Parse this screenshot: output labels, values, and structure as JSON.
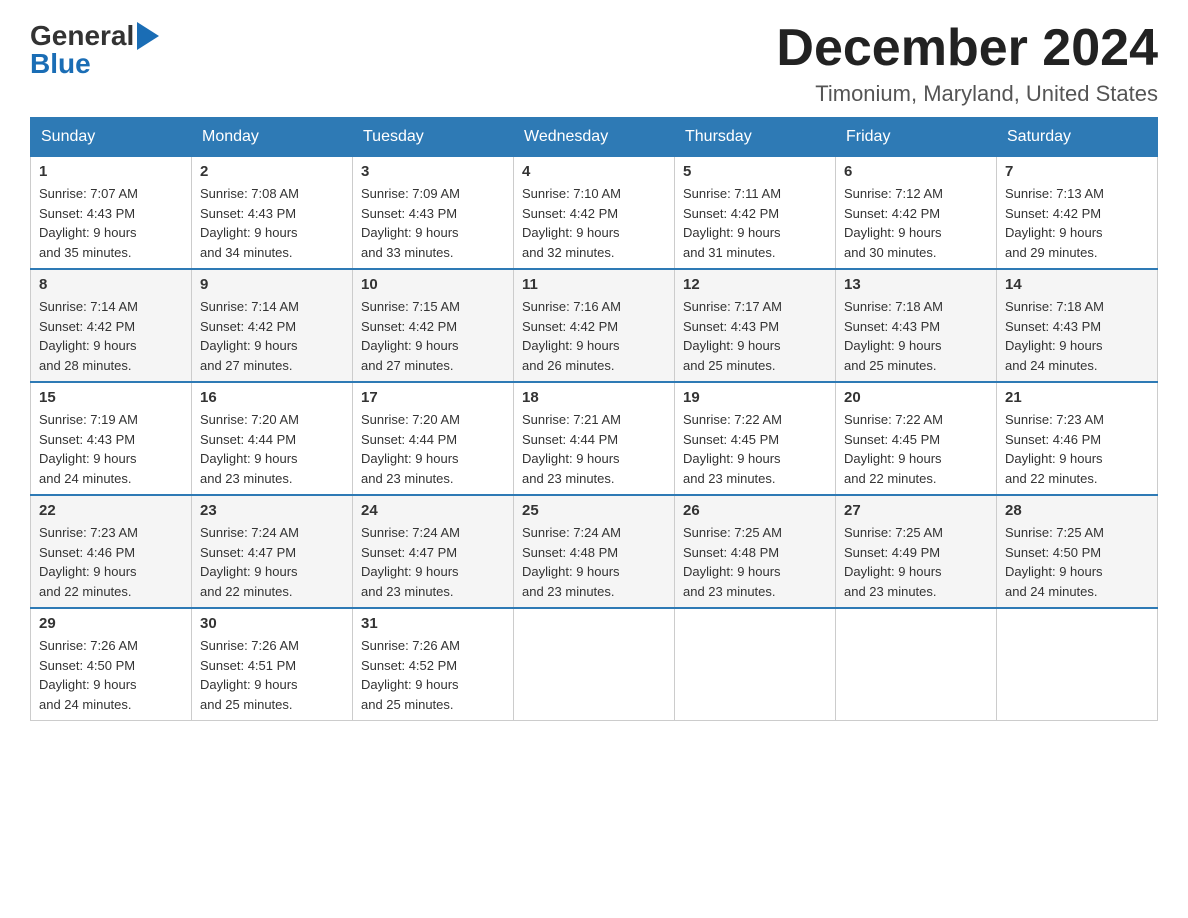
{
  "header": {
    "logo_general": "General",
    "logo_blue": "Blue",
    "month_title": "December 2024",
    "location": "Timonium, Maryland, United States"
  },
  "days_of_week": [
    "Sunday",
    "Monday",
    "Tuesday",
    "Wednesday",
    "Thursday",
    "Friday",
    "Saturday"
  ],
  "weeks": [
    [
      {
        "day": "1",
        "sunrise": "7:07 AM",
        "sunset": "4:43 PM",
        "daylight": "9 hours and 35 minutes."
      },
      {
        "day": "2",
        "sunrise": "7:08 AM",
        "sunset": "4:43 PM",
        "daylight": "9 hours and 34 minutes."
      },
      {
        "day": "3",
        "sunrise": "7:09 AM",
        "sunset": "4:43 PM",
        "daylight": "9 hours and 33 minutes."
      },
      {
        "day": "4",
        "sunrise": "7:10 AM",
        "sunset": "4:42 PM",
        "daylight": "9 hours and 32 minutes."
      },
      {
        "day": "5",
        "sunrise": "7:11 AM",
        "sunset": "4:42 PM",
        "daylight": "9 hours and 31 minutes."
      },
      {
        "day": "6",
        "sunrise": "7:12 AM",
        "sunset": "4:42 PM",
        "daylight": "9 hours and 30 minutes."
      },
      {
        "day": "7",
        "sunrise": "7:13 AM",
        "sunset": "4:42 PM",
        "daylight": "9 hours and 29 minutes."
      }
    ],
    [
      {
        "day": "8",
        "sunrise": "7:14 AM",
        "sunset": "4:42 PM",
        "daylight": "9 hours and 28 minutes."
      },
      {
        "day": "9",
        "sunrise": "7:14 AM",
        "sunset": "4:42 PM",
        "daylight": "9 hours and 27 minutes."
      },
      {
        "day": "10",
        "sunrise": "7:15 AM",
        "sunset": "4:42 PM",
        "daylight": "9 hours and 27 minutes."
      },
      {
        "day": "11",
        "sunrise": "7:16 AM",
        "sunset": "4:42 PM",
        "daylight": "9 hours and 26 minutes."
      },
      {
        "day": "12",
        "sunrise": "7:17 AM",
        "sunset": "4:43 PM",
        "daylight": "9 hours and 25 minutes."
      },
      {
        "day": "13",
        "sunrise": "7:18 AM",
        "sunset": "4:43 PM",
        "daylight": "9 hours and 25 minutes."
      },
      {
        "day": "14",
        "sunrise": "7:18 AM",
        "sunset": "4:43 PM",
        "daylight": "9 hours and 24 minutes."
      }
    ],
    [
      {
        "day": "15",
        "sunrise": "7:19 AM",
        "sunset": "4:43 PM",
        "daylight": "9 hours and 24 minutes."
      },
      {
        "day": "16",
        "sunrise": "7:20 AM",
        "sunset": "4:44 PM",
        "daylight": "9 hours and 23 minutes."
      },
      {
        "day": "17",
        "sunrise": "7:20 AM",
        "sunset": "4:44 PM",
        "daylight": "9 hours and 23 minutes."
      },
      {
        "day": "18",
        "sunrise": "7:21 AM",
        "sunset": "4:44 PM",
        "daylight": "9 hours and 23 minutes."
      },
      {
        "day": "19",
        "sunrise": "7:22 AM",
        "sunset": "4:45 PM",
        "daylight": "9 hours and 23 minutes."
      },
      {
        "day": "20",
        "sunrise": "7:22 AM",
        "sunset": "4:45 PM",
        "daylight": "9 hours and 22 minutes."
      },
      {
        "day": "21",
        "sunrise": "7:23 AM",
        "sunset": "4:46 PM",
        "daylight": "9 hours and 22 minutes."
      }
    ],
    [
      {
        "day": "22",
        "sunrise": "7:23 AM",
        "sunset": "4:46 PM",
        "daylight": "9 hours and 22 minutes."
      },
      {
        "day": "23",
        "sunrise": "7:24 AM",
        "sunset": "4:47 PM",
        "daylight": "9 hours and 22 minutes."
      },
      {
        "day": "24",
        "sunrise": "7:24 AM",
        "sunset": "4:47 PM",
        "daylight": "9 hours and 23 minutes."
      },
      {
        "day": "25",
        "sunrise": "7:24 AM",
        "sunset": "4:48 PM",
        "daylight": "9 hours and 23 minutes."
      },
      {
        "day": "26",
        "sunrise": "7:25 AM",
        "sunset": "4:48 PM",
        "daylight": "9 hours and 23 minutes."
      },
      {
        "day": "27",
        "sunrise": "7:25 AM",
        "sunset": "4:49 PM",
        "daylight": "9 hours and 23 minutes."
      },
      {
        "day": "28",
        "sunrise": "7:25 AM",
        "sunset": "4:50 PM",
        "daylight": "9 hours and 24 minutes."
      }
    ],
    [
      {
        "day": "29",
        "sunrise": "7:26 AM",
        "sunset": "4:50 PM",
        "daylight": "9 hours and 24 minutes."
      },
      {
        "day": "30",
        "sunrise": "7:26 AM",
        "sunset": "4:51 PM",
        "daylight": "9 hours and 25 minutes."
      },
      {
        "day": "31",
        "sunrise": "7:26 AM",
        "sunset": "4:52 PM",
        "daylight": "9 hours and 25 minutes."
      },
      null,
      null,
      null,
      null
    ]
  ],
  "labels": {
    "sunrise": "Sunrise:",
    "sunset": "Sunset:",
    "daylight": "Daylight:"
  }
}
